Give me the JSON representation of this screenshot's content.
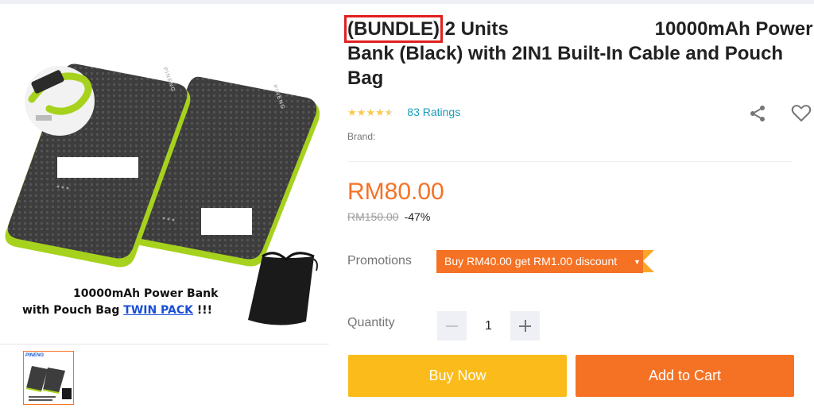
{
  "product": {
    "title_bundle": "(BUNDLE)",
    "title_part1": "2 Units",
    "title_part2": "10000mAh",
    "title_rest": "Power Bank (Black) with 2IN1 Built-In Cable and Pouch Bag",
    "rating_stars": 4.5,
    "ratings_text": "83 Ratings",
    "brand_label": "Brand:",
    "price": "RM80.00",
    "original_price": "RM150.00",
    "discount": "-47%",
    "promotions_label": "Promotions",
    "promotion_text": "Buy RM40.00 get RM1.00 discount",
    "quantity_label": "Quantity",
    "quantity": "1"
  },
  "image": {
    "caption_line1": "10000mAh Power Bank",
    "caption_line2": "with Pouch Bag",
    "caption_twin": "TWIN PACK",
    "caption_bang": "!!!",
    "brand_print": "PINENG",
    "thumb_brand": "PINENG"
  },
  "actions": {
    "buy_now": "Buy Now",
    "add_to_cart": "Add to Cart"
  },
  "icons": {
    "share": "share-icon",
    "wishlist": "heart-icon",
    "star": "star-icon",
    "dropdown": "chevron-down-icon",
    "minus": "minus-icon",
    "plus": "plus-icon"
  },
  "colors": {
    "accent": "#f57224",
    "buy_now": "#fbbb1a",
    "link": "#1a9cb7",
    "highlight_box": "#e02020",
    "star": "#faca51",
    "cable_green": "#a6d21e"
  }
}
